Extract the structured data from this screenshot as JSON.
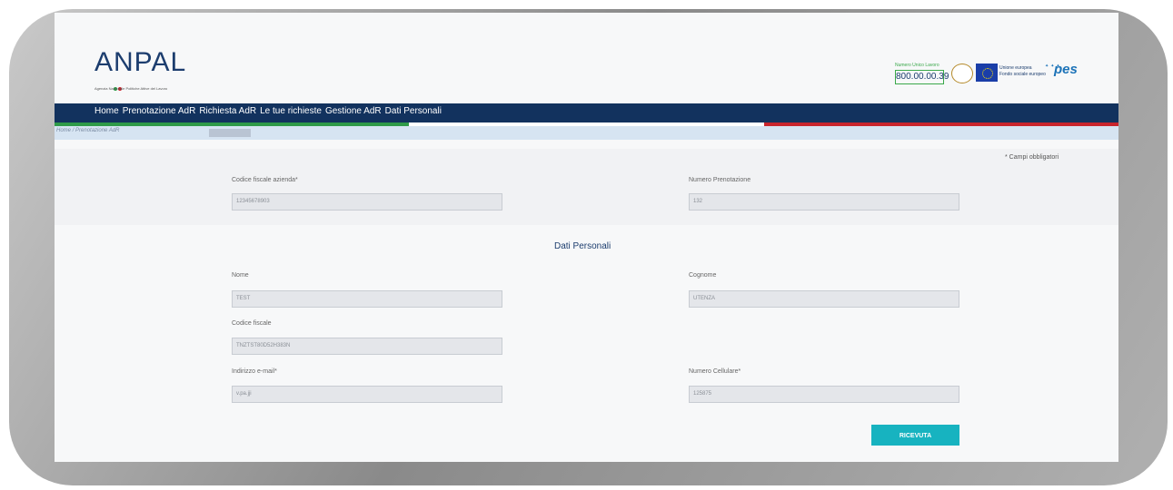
{
  "header": {
    "logo_word": "ANPAL",
    "logo_subtitle": "Agenzia Nazionale Politiche Attive del Lavoro",
    "numero_label": "Numero Unico Lavoro",
    "numero_value": "800.00.00.39",
    "eu_line1": "Unione europea",
    "eu_line2": "Fondo sociale europeo",
    "pes_word": "pes"
  },
  "nav": {
    "items": [
      "Home",
      "Prenotazione AdR",
      "Richiesta AdR",
      "Le tue richieste",
      "Gestione AdR",
      "Dati Personali"
    ]
  },
  "breadcrumb": {
    "home": "Home",
    "separator": "/",
    "current": "Prenotazione AdR"
  },
  "form": {
    "required_note": "* Campi obbligatori",
    "codice_fiscale_azienda_label": "Codice fiscale azienda*",
    "codice_fiscale_azienda_value": "12345678903",
    "numero_prenotazione_label": "Numero Prenotazione",
    "numero_prenotazione_value": "132",
    "section_title": "Dati Personali",
    "nome_label": "Nome",
    "nome_value": "TEST",
    "cognome_label": "Cognome",
    "cognome_value": "UTENZA",
    "codice_fiscale_label": "Codice fiscale",
    "codice_fiscale_value": "TNZTST80D52H383N",
    "email_label": "Indirizzo e-mail*",
    "email_value": "v.pa.jji",
    "cellulare_label": "Numero Cellulare*",
    "cellulare_value": "125875",
    "submit_label": "RICEVUTA"
  },
  "colors": {
    "navy": "#12325e",
    "green": "#2e9a48",
    "red": "#c8242c",
    "teal": "#17b3c0"
  }
}
